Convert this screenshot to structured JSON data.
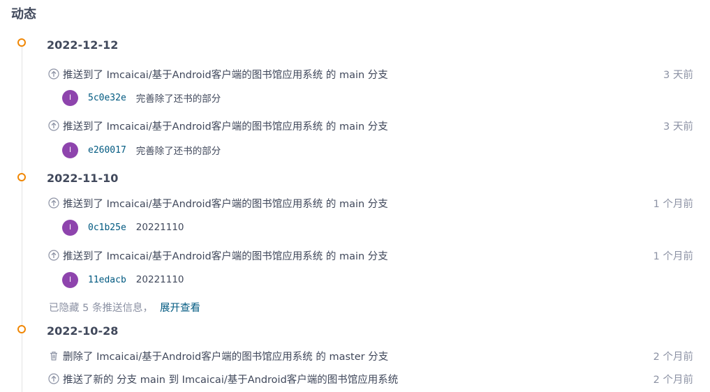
{
  "page_title": "动态",
  "groups": [
    {
      "date": "2022-12-12",
      "events": [
        {
          "icon": "push-icon",
          "verb": "推送到了",
          "repo": "Imcaicai/基于Android客户端的图书馆应用系统",
          "mid": "的",
          "branch": "main",
          "suffix": "分支",
          "time": "3 天前",
          "commit": {
            "avatar": "I",
            "sha": "5c0e32e",
            "message": "完善除了还书的部分"
          }
        },
        {
          "icon": "push-icon",
          "verb": "推送到了",
          "repo": "Imcaicai/基于Android客户端的图书馆应用系统",
          "mid": "的",
          "branch": "main",
          "suffix": "分支",
          "time": "3 天前",
          "commit": {
            "avatar": "I",
            "sha": "e260017",
            "message": "完善除了还书的部分"
          }
        }
      ]
    },
    {
      "date": "2022-11-10",
      "events": [
        {
          "icon": "push-icon",
          "verb": "推送到了",
          "repo": "Imcaicai/基于Android客户端的图书馆应用系统",
          "mid": "的",
          "branch": "main",
          "suffix": "分支",
          "time": "1 个月前",
          "commit": {
            "avatar": "I",
            "sha": "0c1b25e",
            "message": "20221110"
          }
        },
        {
          "icon": "push-icon",
          "verb": "推送到了",
          "repo": "Imcaicai/基于Android客户端的图书馆应用系统",
          "mid": "的",
          "branch": "main",
          "suffix": "分支",
          "time": "1 个月前",
          "commit": {
            "avatar": "I",
            "sha": "11edacb",
            "message": "20221110"
          }
        }
      ],
      "hidden_note": {
        "text": "已隐藏 5 条推送信息，",
        "expand": "展开查看"
      }
    },
    {
      "date": "2022-10-28",
      "events": [
        {
          "icon": "trash-icon",
          "verb": "删除了",
          "repo": "Imcaicai/基于Android客户端的图书馆应用系统",
          "mid": "的",
          "branch": "master",
          "suffix": "分支",
          "time": "2 个月前"
        },
        {
          "icon": "push-icon",
          "verb": "推送了新的",
          "mid": "分支",
          "branch": "main",
          "suffix": "到",
          "repo": "Imcaicai/基于Android客户端的图书馆应用系统",
          "time": "2 个月前"
        }
      ]
    }
  ],
  "colors": {
    "accent": "#f08705",
    "link": "#005980",
    "text": "#40485b",
    "muted": "#8c92a4",
    "avatar": "#8e44ad"
  }
}
